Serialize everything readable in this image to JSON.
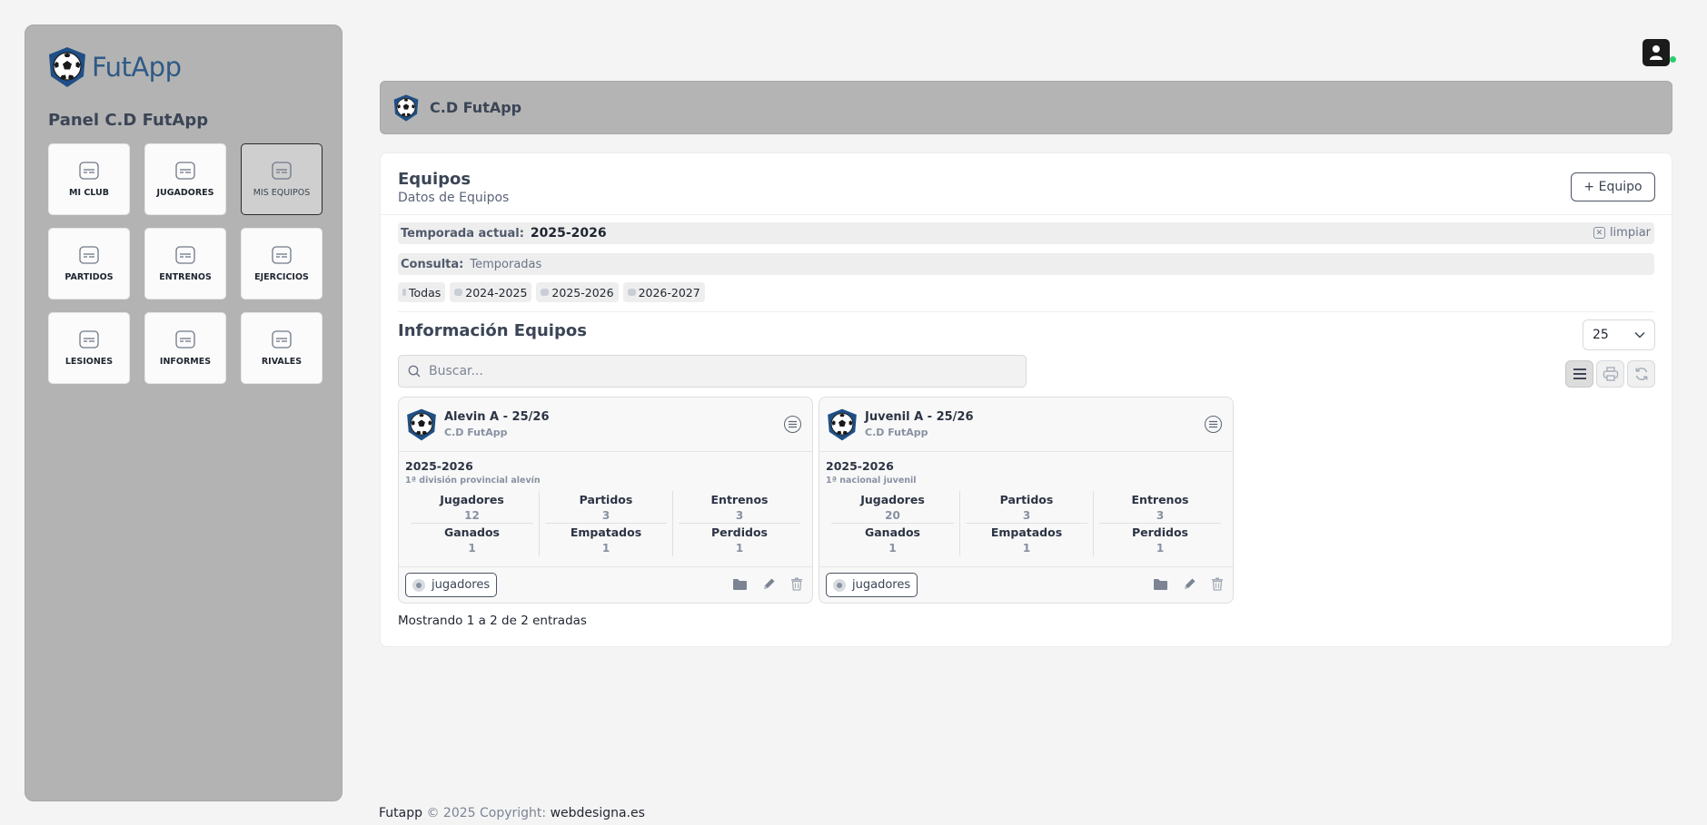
{
  "brand": {
    "name": "FutApp"
  },
  "sidebar": {
    "panel_title": "Panel C.D FutApp",
    "tiles": [
      {
        "label": "MI CLUB",
        "active": false
      },
      {
        "label": "JUGADORES",
        "active": false
      },
      {
        "label": "MIS EQUIPOS",
        "active": true
      },
      {
        "label": "PARTIDOS",
        "active": false
      },
      {
        "label": "ENTRENOS",
        "active": false
      },
      {
        "label": "EJERCICIOS",
        "active": false
      },
      {
        "label": "LESIONES",
        "active": false
      },
      {
        "label": "INFORMES",
        "active": false
      },
      {
        "label": "RIVALES",
        "active": false
      }
    ]
  },
  "header": {
    "club_name": "C.D FutApp"
  },
  "section": {
    "title": "Equipos",
    "subtitle": "Datos de Equipos",
    "add_button": "+ Equipo"
  },
  "filters": {
    "current_label": "Temporada actual:",
    "current_value": "2025-2026",
    "clear_label": "limpiar",
    "query_label": "Consulta:",
    "query_value": "Temporadas",
    "chips": [
      "Todas",
      "2024-2025",
      "2025-2026",
      "2026-2027"
    ]
  },
  "info": {
    "title": "Información Equipos",
    "page_size": "25",
    "search_placeholder": "Buscar..."
  },
  "teams": [
    {
      "name": "Alevin A - 25/26",
      "club": "C.D FutApp",
      "season": "2025-2026",
      "division": "1ª división provincial alevín",
      "stats": {
        "jugadores_label": "Jugadores",
        "jugadores": "12",
        "partidos_label": "Partidos",
        "partidos": "3",
        "entrenos_label": "Entrenos",
        "entrenos": "3",
        "ganados_label": "Ganados",
        "ganados": "1",
        "empatados_label": "Empatados",
        "empatados": "1",
        "perdidos_label": "Perdidos",
        "perdidos": "1"
      },
      "players_button": "jugadores"
    },
    {
      "name": "Juvenil A - 25/26",
      "club": "C.D FutApp",
      "season": "2025-2026",
      "division": "1ª nacional juvenil",
      "stats": {
        "jugadores_label": "Jugadores",
        "jugadores": "20",
        "partidos_label": "Partidos",
        "partidos": "3",
        "entrenos_label": "Entrenos",
        "entrenos": "3",
        "ganados_label": "Ganados",
        "ganados": "1",
        "empatados_label": "Empatados",
        "empatados": "1",
        "perdidos_label": "Perdidos",
        "perdidos": "1"
      },
      "players_button": "jugadores"
    }
  ],
  "pagination": {
    "summary": "Mostrando 1 a 2 de 2 entradas"
  },
  "footer": {
    "app": "Futapp",
    "copyright": "© 2025 Copyright:",
    "link": "webdesigna.es"
  },
  "colors": {
    "sidebar_bg": "#b3b3b3",
    "header_bar_bg": "#b4b4b4",
    "text_primary": "#3b4556",
    "text_muted": "#8891a2",
    "status_online": "#2ecc71"
  }
}
